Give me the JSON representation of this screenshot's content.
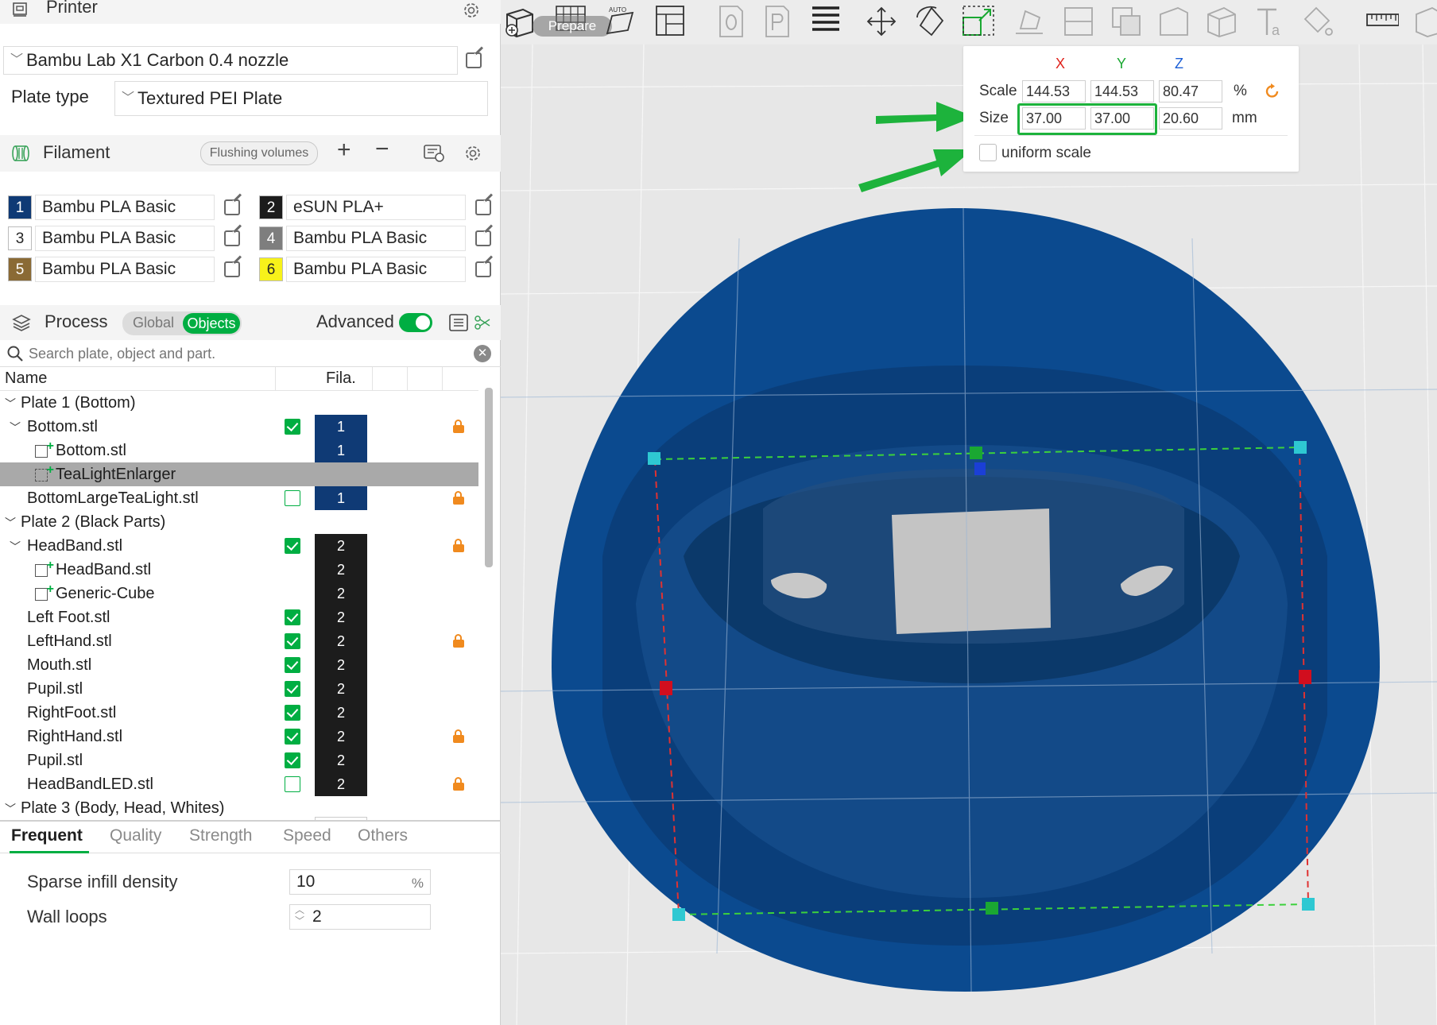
{
  "printer": {
    "title": "Printer",
    "printer_name": "Bambu Lab X1 Carbon 0.4 nozzle",
    "plate_type_label": "Plate type",
    "plate_type_value": "Textured PEI Plate"
  },
  "filament": {
    "title": "Filament",
    "flushing_label": "Flushing volumes",
    "items": [
      {
        "num": "1",
        "name": "Bambu PLA Basic",
        "color": "#0f3a75",
        "text_color": "#ffffff"
      },
      {
        "num": "2",
        "name": "eSUN PLA+",
        "color": "#1c1c1c",
        "text_color": "#ffffff"
      },
      {
        "num": "3",
        "name": "Bambu PLA Basic",
        "color": "#ffffff",
        "text_color": "#262626"
      },
      {
        "num": "4",
        "name": "Bambu PLA Basic",
        "color": "#7e7e7e",
        "text_color": "#ffffff"
      },
      {
        "num": "5",
        "name": "Bambu PLA Basic",
        "color": "#8a6a35",
        "text_color": "#ffffff"
      },
      {
        "num": "6",
        "name": "Bambu PLA Basic",
        "color": "#f7f21a",
        "text_color": "#262626"
      }
    ]
  },
  "process": {
    "title": "Process",
    "global_label": "Global",
    "objects_label": "Objects",
    "advanced_label": "Advanced",
    "advanced_on": true
  },
  "search": {
    "placeholder": "Search plate, object and part."
  },
  "tree": {
    "col_name": "Name",
    "col_fila": "Fila.",
    "rows": [
      {
        "label": "Plate 1 (Bottom)",
        "level": 0,
        "caret": true
      },
      {
        "label": "Bottom.stl",
        "level": 1,
        "caret": true,
        "check": "on",
        "fila": "1",
        "lock": true
      },
      {
        "label": "Bottom.stl",
        "level": 2,
        "sub": true,
        "fila": "1"
      },
      {
        "label": "TeaLightEnlarger",
        "level": 2,
        "sub": true,
        "selected": true
      },
      {
        "label": "BottomLargeTeaLight.stl",
        "level": 1,
        "check": "off",
        "fila": "1",
        "lock": true
      },
      {
        "label": "Plate 2 (Black Parts)",
        "level": 0,
        "caret": true
      },
      {
        "label": "HeadBand.stl",
        "level": 1,
        "caret": true,
        "check": "on",
        "fila": "2",
        "lock": true
      },
      {
        "label": "HeadBand.stl",
        "level": 2,
        "sub": true,
        "fila": "2"
      },
      {
        "label": "Generic-Cube",
        "level": 2,
        "sub": true,
        "fila": "2"
      },
      {
        "label": "Left Foot.stl",
        "level": 1,
        "check": "on",
        "fila": "2"
      },
      {
        "label": "LeftHand.stl",
        "level": 1,
        "check": "on",
        "fila": "2",
        "lock": true
      },
      {
        "label": "Mouth.stl",
        "level": 1,
        "check": "on",
        "fila": "2"
      },
      {
        "label": "Pupil.stl",
        "level": 1,
        "check": "on",
        "fila": "2"
      },
      {
        "label": "RightFoot.stl",
        "level": 1,
        "check": "on",
        "fila": "2"
      },
      {
        "label": "RightHand.stl",
        "level": 1,
        "check": "on",
        "fila": "2",
        "lock": true
      },
      {
        "label": "Pupil.stl",
        "level": 1,
        "check": "on",
        "fila": "2"
      },
      {
        "label": "HeadBandLED.stl",
        "level": 1,
        "check": "off",
        "fila": "2",
        "lock": true
      },
      {
        "label": "Plate 3 (Body, Head, Whites)",
        "level": 0,
        "caret": true
      }
    ]
  },
  "tabs": {
    "items": [
      "Frequent",
      "Quality",
      "Strength",
      "Speed",
      "Others"
    ],
    "active": "Frequent"
  },
  "params": {
    "infill_label": "Sparse infill density",
    "infill_value": "10",
    "infill_unit": "%",
    "wall_label": "Wall loops",
    "wall_value": "2"
  },
  "toolbar": {
    "overlay_text": "Prepare"
  },
  "scale_panel": {
    "axis_x": "X",
    "axis_y": "Y",
    "axis_z": "Z",
    "scale_label": "Scale",
    "scale_x": "144.53",
    "scale_y": "144.53",
    "scale_z": "80.47",
    "scale_unit": "%",
    "size_label": "Size",
    "size_x": "37.00",
    "size_y": "37.00",
    "size_z": "20.60",
    "size_unit": "mm",
    "uniform_label": "uniform scale",
    "uniform_checked": false
  },
  "colors": {
    "accent_green": "#00ae42",
    "axis_x": "#e0221b",
    "axis_y": "#1aa832",
    "axis_z": "#1b5fd6",
    "model_blue": "#0b4a8f",
    "annotation_arrow": "#1db33c",
    "lock_orange": "#f08a1e"
  }
}
